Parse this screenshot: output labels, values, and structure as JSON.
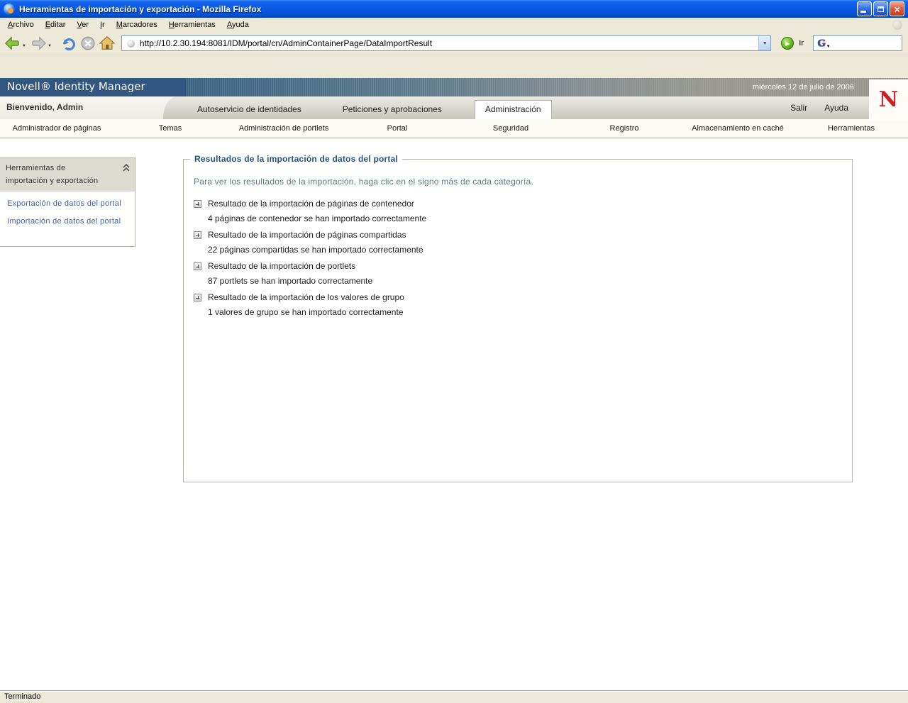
{
  "window": {
    "title": "Herramientas de importación y exportación - Mozilla Firefox"
  },
  "menubar": {
    "items": [
      {
        "label": "Archivo"
      },
      {
        "label": "Editar"
      },
      {
        "label": "Ver"
      },
      {
        "label": "Ir"
      },
      {
        "label": "Marcadores"
      },
      {
        "label": "Herramientas"
      },
      {
        "label": "Ayuda"
      }
    ]
  },
  "toolbar": {
    "url": "http://10.2.30.194:8081/IDM/portal/cn/AdminContainerPage/DataImportResult",
    "go_label": "Ir",
    "search_engine_letter": "G"
  },
  "banner": {
    "brand": "Novell® Identity Manager",
    "date": "miércoles 12 de julio de 2006",
    "logo_letter": "N"
  },
  "welcome": {
    "text": "Bienvenido, Admin"
  },
  "tabs": {
    "items": [
      {
        "label": "Autoservicio de identidades",
        "active": false
      },
      {
        "label": "Peticiones y aprobaciones",
        "active": false
      },
      {
        "label": "Administración",
        "active": true
      }
    ]
  },
  "session_links": {
    "logout": "Salir",
    "help": "Ayuda"
  },
  "subnav": {
    "items": [
      {
        "label": "Administrador de páginas"
      },
      {
        "label": "Temas"
      },
      {
        "label": "Administración de portlets"
      },
      {
        "label": "Portal"
      },
      {
        "label": "Seguridad"
      },
      {
        "label": "Registro"
      },
      {
        "label": "Almacenamiento en caché"
      },
      {
        "label": "Herramientas"
      }
    ]
  },
  "sidebar": {
    "title_lines": [
      "Herramientas de",
      "importación y exportación"
    ],
    "links": [
      {
        "label": "Exportación de datos del portal"
      },
      {
        "label": "Importación de datos del portal"
      }
    ]
  },
  "content": {
    "legend": "Resultados de la importación de datos del portal",
    "intro": "Para ver los resultados de la importación, haga clic en el signo más de cada categoría.",
    "results": [
      {
        "title": "Resultado de la importación de páginas de contenedor",
        "detail": "4 páginas de contenedor se han importado correctamente"
      },
      {
        "title": "Resultado de la importación de páginas compartidas",
        "detail": "22 páginas compartidas se han importado correctamente"
      },
      {
        "title": "Resultado de la importación de portlets",
        "detail": "87 portlets se han importado correctamente"
      },
      {
        "title": "Resultado de la importación de los valores de grupo",
        "detail": "1 valores de grupo se han importado correctamente"
      }
    ]
  },
  "statusbar": {
    "text": "Terminado"
  },
  "colors": {
    "novell_blue": "#315681",
    "titlebar_blue": "#0a5ae4",
    "link_blue": "#3e64a8",
    "legend_blue": "#2a527c",
    "intro_teal": "#5e7f7f",
    "novell_red": "#cc2129",
    "chrome_beige": "#ece9d8"
  }
}
